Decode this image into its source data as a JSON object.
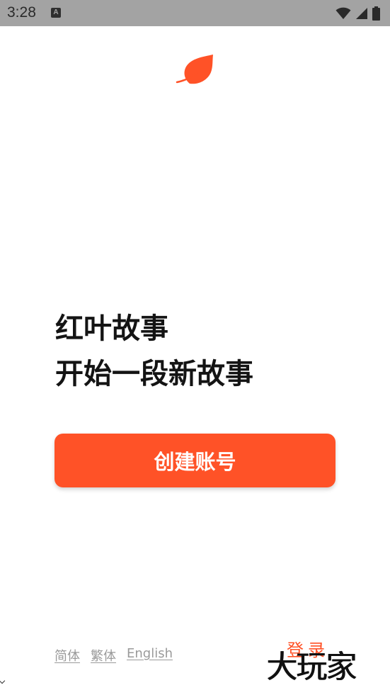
{
  "status_bar": {
    "time": "3:28",
    "notification_icon_letter": "A",
    "icons": [
      "wifi-icon",
      "cellular-signal-icon",
      "battery-icon"
    ]
  },
  "logo": {
    "icon": "leaf-icon",
    "color": "#ff5227"
  },
  "headline": {
    "line1": "红叶故事",
    "line2": "开始一段新故事"
  },
  "create_account": {
    "label": "创建账号",
    "color": "#ff5227"
  },
  "languages": {
    "simplified": "简体",
    "traditional": "繁体",
    "english": "English"
  },
  "login": {
    "label": "登录"
  },
  "watermark": {
    "text": "大玩家"
  }
}
